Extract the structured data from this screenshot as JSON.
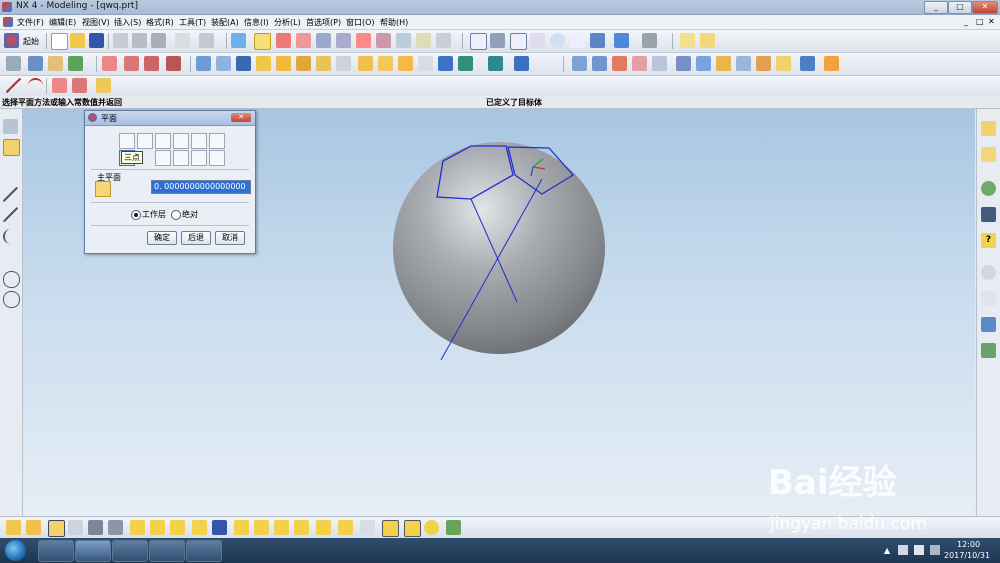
{
  "window": {
    "title": "NX 4 - Modeling - [qwq.prt]"
  },
  "menu": [
    "文件(F)",
    "编辑(E)",
    "视图(V)",
    "插入(S)",
    "格式(R)",
    "工具(T)",
    "装配(A)",
    "信息(I)",
    "分析(L)",
    "首选项(P)",
    "窗口(O)",
    "帮助(H)"
  ],
  "toolbar": {
    "start_label": "起始"
  },
  "prompt": {
    "left": "选择平面方法或输入常数值并返回",
    "center": "已定义了目标体"
  },
  "dialog": {
    "title": "平面",
    "tooltip": "三点",
    "section_label": "主平面",
    "value": "0. 0000000000000000",
    "radio_work": "工作层",
    "radio_abs": "绝对",
    "ok": "确定",
    "back": "后退",
    "cancel": "取消"
  },
  "watermark": {
    "brand": "Bai经验",
    "url": "jingyan.baidu.com"
  },
  "taskbar": {
    "time": "12:00",
    "date": "2017/10/31"
  },
  "colors": {
    "accent": "#3a6fd8",
    "curve": "#1f2fd0",
    "sphere": "#9a9da1"
  }
}
